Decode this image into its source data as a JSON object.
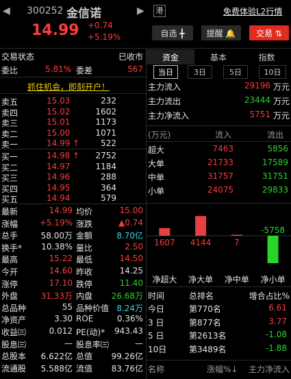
{
  "header": {
    "back_icon": "chevron-left-icon",
    "code": "300252",
    "name": "金信诺",
    "forward_icon": "chevron-right-icon",
    "exchange_badge": "港",
    "l2_link": "免费体验L2行情",
    "price": "14.99",
    "change": "+0.74",
    "change_pct": "+5.19%",
    "watchlist_button": "自选 ╋",
    "alert_button": "提醒 🔔",
    "trade_button": "交易 ⇅",
    "watchlist_icon": "plus-icon",
    "alert_icon": "bell-icon",
    "trade_icon": "swap-arrows-icon"
  },
  "left": {
    "status_label": "交易状态",
    "status_value": "已收市",
    "weibi_label": "委比",
    "weibi_value": "5.81%",
    "weicha_label": "委差",
    "weicha_value": "567",
    "promo": "抓住机会，即刻开户！",
    "asks": [
      {
        "label": "卖五",
        "price": "15.03",
        "vol": "232",
        "arrow": ""
      },
      {
        "label": "卖四",
        "price": "15.02",
        "vol": "1602",
        "arrow": ""
      },
      {
        "label": "卖三",
        "price": "15.01",
        "vol": "1173",
        "arrow": ""
      },
      {
        "label": "卖二",
        "price": "15.00",
        "vol": "1071",
        "arrow": ""
      },
      {
        "label": "卖一",
        "price": "14.99",
        "vol": "522",
        "arrow": "↑"
      }
    ],
    "bids": [
      {
        "label": "买一",
        "price": "14.98",
        "vol": "2752",
        "arrow": "↑"
      },
      {
        "label": "买二",
        "price": "14.97",
        "vol": "1184",
        "arrow": ""
      },
      {
        "label": "买三",
        "price": "14.96",
        "vol": "288",
        "arrow": ""
      },
      {
        "label": "买四",
        "price": "14.95",
        "vol": "364",
        "arrow": ""
      },
      {
        "label": "买五",
        "price": "14.94",
        "vol": "579",
        "arrow": ""
      }
    ],
    "stats": [
      {
        "l1": "最新",
        "v1": "14.99",
        "c1": "red",
        "l2": "均价",
        "v2": "15.00",
        "c2": "red"
      },
      {
        "l1": "涨幅",
        "v1": "+5.19%",
        "c1": "red",
        "l2": "涨跌",
        "v2": "▲0.74",
        "c2": "red"
      },
      {
        "l1": "总手",
        "v1": "58.00万",
        "c1": "white",
        "l2": "金额",
        "v2": "8.70亿",
        "c2": "cyan"
      },
      {
        "l1": "换手*",
        "v1": "10.38%",
        "c1": "white",
        "l2": "量比",
        "v2": "2.50",
        "c2": "red"
      },
      {
        "l1": "最高",
        "v1": "15.22",
        "c1": "red",
        "l2": "最低",
        "v2": "14.50",
        "c2": "red"
      },
      {
        "l1": "今开",
        "v1": "14.60",
        "c1": "red",
        "l2": "昨收",
        "v2": "14.25",
        "c2": "white"
      },
      {
        "l1": "涨停",
        "v1": "17.10",
        "c1": "red",
        "l2": "跌停",
        "v2": "11.40",
        "c2": "green"
      },
      {
        "l1": "外盘",
        "v1": "31.33万",
        "c1": "red",
        "l2": "内盘",
        "v2": "26.68万",
        "c2": "green"
      },
      {
        "l1": "总品种",
        "v1": "55",
        "c1": "white",
        "l2": "品种价值",
        "v2": "8.24万",
        "c2": "cyan"
      },
      {
        "l1": "净资产",
        "v1": "3.30",
        "c1": "white",
        "l2": "ROE",
        "v2": "0.36%",
        "c2": "white"
      },
      {
        "l1": "收益㈢",
        "v1": "0.012",
        "c1": "white",
        "l2": "PE(动)*",
        "v2": "943.43",
        "c2": "white"
      },
      {
        "l1": "股息㈢",
        "v1": "—",
        "c1": "white",
        "l2": "股息率㈢",
        "v2": "—",
        "c2": "white"
      },
      {
        "l1": "总股本",
        "v1": "6.622亿",
        "c1": "white",
        "l2": "总值",
        "v2": "99.26亿",
        "c2": "white"
      },
      {
        "l1": "流通股",
        "v1": "5.588亿",
        "c1": "white",
        "l2": "流值",
        "v2": "83.76亿",
        "c2": "white"
      }
    ]
  },
  "right": {
    "tabs": [
      "资金",
      "基本",
      "指数"
    ],
    "subtabs": [
      "当日",
      "3日",
      "5日",
      "10日"
    ],
    "flows": [
      {
        "label": "主力流入",
        "value": "29196",
        "unit": "万元",
        "color": "red"
      },
      {
        "label": "主力流出",
        "value": "23444",
        "unit": "万元",
        "color": "green"
      },
      {
        "label": "主力净流入",
        "value": "5751",
        "unit": "万元",
        "color": "red"
      }
    ],
    "table_header": {
      "unit": "(万元)",
      "in": "流入",
      "out": "流出"
    },
    "table_rows": [
      {
        "label": "超大",
        "in": "7463",
        "out": "5856"
      },
      {
        "label": "大单",
        "in": "21733",
        "out": "17589"
      },
      {
        "label": "中单",
        "in": "31757",
        "out": "31751"
      },
      {
        "label": "小单",
        "in": "24075",
        "out": "29833"
      }
    ],
    "rank_header": {
      "time": "时间",
      "rank": "总排名",
      "pct": "增合占比%"
    },
    "rank_rows": [
      {
        "time": "今日",
        "rank": "第770名",
        "pct": "6.61",
        "color": "red"
      },
      {
        "time": "3 日",
        "rank": "第877名",
        "pct": "3.77",
        "color": "red"
      },
      {
        "time": "5 日",
        "rank": "第2613名",
        "pct": "-1.08",
        "color": "green"
      },
      {
        "time": "10日",
        "rank": "第3489名",
        "pct": "-1.88",
        "color": "green"
      }
    ],
    "sector_header": {
      "name": "名称",
      "change": "涨幅%↓",
      "net": "主力净流入"
    }
  },
  "chart_data": {
    "type": "bar",
    "categories": [
      "净超大",
      "净大单",
      "净中单",
      "净小单"
    ],
    "values": [
      1607,
      4144,
      7,
      -5758
    ],
    "value_labels": [
      "1607",
      "4144",
      "7",
      "-5758"
    ],
    "colors": [
      "#e84040",
      "#e84040",
      "#e84040",
      "#2bd42b"
    ]
  },
  "colors": {
    "up": "#ff3b3b",
    "down": "#2bd42b",
    "accent": "#f0d000"
  }
}
